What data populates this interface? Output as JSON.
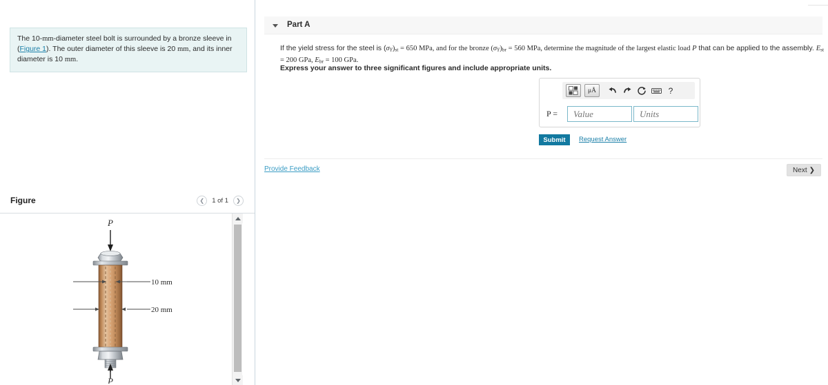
{
  "left_panel": {
    "problem_statement": {
      "part1": "The 10-",
      "unit1": "mm",
      "part2": "-diameter steel bolt is surrounded by a bronze sleeve in (",
      "figure_link": "Figure 1",
      "part3": "). The outer diameter of this sleeve is 20 ",
      "unit2": "mm",
      "part4": ", and its inner diameter is 10 ",
      "unit3": "mm",
      "part5": "."
    },
    "figure_section": {
      "title": "Figure",
      "pager_label": "1 of 1",
      "prev_icon": "chevron-left-icon",
      "next_icon": "chevron-right-icon"
    },
    "figure_labels": {
      "load_top": "P",
      "load_bottom": "P",
      "inner_diameter": "10 mm",
      "outer_diameter": "20 mm"
    },
    "scrollbar": {
      "up_icon": "triangle-up-icon",
      "down_icon": "triangle-down-icon"
    }
  },
  "right_panel": {
    "part_header": {
      "caret_icon": "caret-down-icon",
      "label": "Part A"
    },
    "question": {
      "seg1": "If the yield stress for the steel is (",
      "sigma1": "σ",
      "sub_y1": "Y",
      "seg2": ")",
      "sub_st": "st",
      "seg3": " = 650 MPa, and for the bronze (",
      "sigma2": "σ",
      "sub_y2": "Y",
      "seg4": ")",
      "sub_br": "br",
      "seg5": " = 560 MPa, determine the magnitude of the largest elastic load ",
      "var_p": "P",
      "seg6": " that can be applied to the assembly. ",
      "var_e1": "E",
      "sub_st2": "st",
      "seg7": " = 200 GPa, ",
      "var_e2": "E",
      "sub_br2": "br",
      "seg8": " = 100 GPa."
    },
    "instruction": "Express your answer to three significant figures and include appropriate units.",
    "toolbar": {
      "template_icon": "math-template-icon",
      "units_icon": "micro-angstrom-units-icon",
      "units_label": "μÅ",
      "undo_icon": "undo-arrow-icon",
      "redo_icon": "redo-arrow-icon",
      "reset_icon": "reset-circle-icon",
      "keyboard_icon": "keyboard-icon",
      "help_icon": "help-question-icon",
      "help_label": "?"
    },
    "answer": {
      "equation_lhs": "P =",
      "value_placeholder": "Value",
      "units_placeholder": "Units",
      "value": "",
      "units": ""
    },
    "submit_label": "Submit",
    "request_answer_label": "Request Answer",
    "provide_feedback_label": "Provide Feedback",
    "next_label": "Next",
    "next_chevron": "❯"
  },
  "colors": {
    "accent_blue": "#1279a0",
    "link_blue": "#1a7fa8",
    "problem_bg": "#e9f4f4",
    "header_bg": "#f7f7f7",
    "bronze": "#c08a5a",
    "steel": "#b9bcc1"
  }
}
